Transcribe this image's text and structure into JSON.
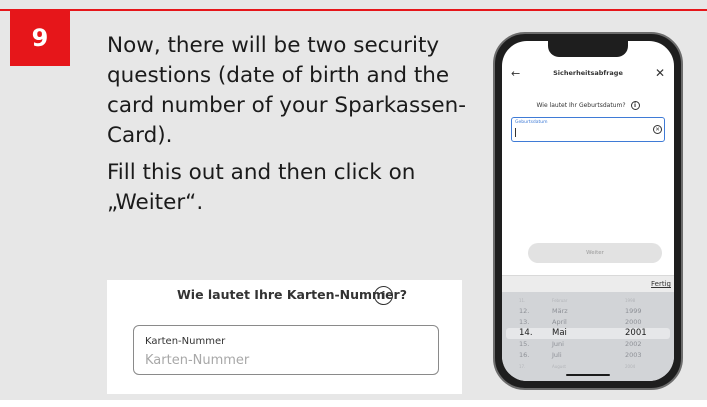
{
  "step": {
    "number": "9"
  },
  "instructions": {
    "line1": "Now, there will be two security questions (date of birth and the card number of your Sparkassen-Card).",
    "line2": "Fill this out and then click on „Weiter“."
  },
  "card_form": {
    "question": "Wie lautet Ihre Karten-Nummer?",
    "info_icon": "info-icon",
    "field_label": "Karten-Nummer",
    "field_placeholder": "Karten-Nummer"
  },
  "phone": {
    "nav": {
      "back": "←",
      "title": "Sicherheitsabfrage",
      "close": "✕"
    },
    "question": "Wie lautet Ihr Geburtsdatum?",
    "date_field": {
      "label": "Geburtsdatum",
      "value": ""
    },
    "continue_label": "Weiter",
    "done_label": "Fertig",
    "picker": {
      "top_row": [
        "11.",
        "Februar",
        "1998"
      ],
      "rows": [
        [
          "12.",
          "März",
          "1999"
        ],
        [
          "13.",
          "April",
          "2000"
        ],
        [
          "14.",
          "Mai",
          "2001"
        ],
        [
          "15.",
          "Juni",
          "2002"
        ],
        [
          "16.",
          "Juli",
          "2003"
        ]
      ],
      "bottom_row": [
        "17.",
        "August",
        "2004"
      ],
      "selected": [
        "14.",
        "Mai",
        "2001"
      ]
    }
  },
  "colors": {
    "brand_red": "#e6161a",
    "focus_blue": "#3f7bd6",
    "background": "#e7e7e7"
  }
}
